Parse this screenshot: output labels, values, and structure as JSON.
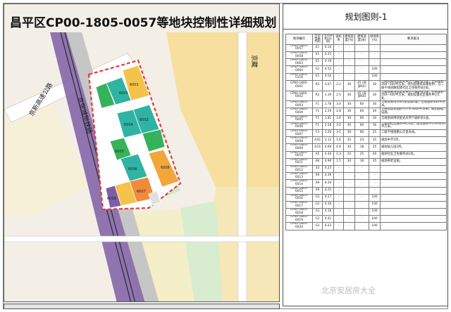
{
  "map": {
    "title": "昌平区CP00-1805-0057等地块控制性详细规划",
    "roads": {
      "expressway": "京新高速公路",
      "railway": "京张城际铁路",
      "beijing_tibet": "京藏"
    },
    "parcels": [
      {
        "label": "6001"
      },
      {
        "label": "6002"
      },
      {
        "label": "6003"
      },
      {
        "label": "6004"
      },
      {
        "label": "6005"
      },
      {
        "label": "6006"
      },
      {
        "label": "6007"
      },
      {
        "label": "6008"
      },
      {
        "label": "6009"
      }
    ],
    "colors": {
      "residential": "#f5c24a",
      "public_service": "#f28a3b",
      "green": "#35b35a",
      "teal": "#2fb3a3",
      "boundary": "#e23b3b",
      "road": "#ffffff",
      "railway_band": "#7d5ea6"
    }
  },
  "sheet": {
    "title": "规划图则-1"
  },
  "table": {
    "headers": [
      "地块编号",
      "用地性质代码",
      "用地面积(公顷)",
      "容积率",
      "建筑密度(%)",
      "建筑高度(米)",
      "绿地率(%)",
      "要求备注"
    ],
    "rows": [
      [
        "CP00-1805-0057",
        "E1",
        "0.14",
        "-",
        "-",
        "-",
        "-",
        "-"
      ],
      [
        "CP00-1805-0058",
        "E1",
        "0.25",
        "-",
        "-",
        "-",
        "-",
        "-"
      ],
      [
        "CP00-1805-0063",
        "E1",
        "0.19",
        "-",
        "-",
        "-",
        "-",
        "-"
      ],
      [
        "CP00-1805-0064",
        "G1",
        "0.52",
        "-",
        "-",
        "-",
        "100",
        "-"
      ],
      [
        "CP00-1805-0116",
        "E1",
        "0.54",
        "-",
        "-",
        "-",
        "100",
        "-"
      ],
      [
        "CP00-1805-6001",
        "R2",
        "3.07",
        "2.2",
        "30",
        "45 (局部60)",
        "30",
        "全规划采用装配式天然气锅炉房1座，占地面积200~300平方米，供内部建筑采暖使用；沿二级干线道路配建社区卫生服务站1处。"
      ],
      [
        "CP00-1805-6002",
        "R2",
        "3.19",
        "2.5",
        "30",
        "45 (局部60)",
        "30",
        "全规划采用装配式天然气锅炉房1座，占地面积200~300平方米，规划设置社区服务中心1处。"
      ],
      [
        "CP00-1805-6003",
        "F1",
        "1.78",
        "3.0",
        "30",
        "60",
        "30",
        "全规划采用10kV变电站1座，占地面积300平方米。"
      ],
      [
        "CP00-1805-6004",
        "F1",
        "2.29",
        "2.8",
        "30",
        "60",
        "30",
        "全规划建筑面积不少于5000平方米，规划基础设施。"
      ],
      [
        "CP00-1805-6005",
        "F1",
        "1.81",
        "3.0",
        "30",
        "60",
        "30",
        "全规划采用装配式天然气锅炉房1座。"
      ],
      [
        "CP00-1805-6006",
        "F1",
        "2.58",
        "3.0",
        "30",
        "60",
        "30",
        "全规划社区服务中心1处，建筑面积不小于6000平方米。"
      ],
      [
        "CP00-1805-6007",
        "F3",
        "1.20",
        "3.5",
        "30",
        "60",
        "25",
        "二级干线道路公交首末站。"
      ],
      [
        "CP00-1805-6008",
        "A33",
        "2.12",
        "1.6",
        "35",
        "24",
        "35",
        "规划中学1所。"
      ],
      [
        "CP00-1805-6009",
        "A33",
        "0.69",
        "0.9",
        "30",
        "18",
        "35",
        "规划幼儿园1所。"
      ],
      [
        "CP00-1805-6010",
        "A5",
        "0.30",
        "1.3",
        "25",
        "25",
        "40",
        "规划社区卫生服务站1处。"
      ],
      [
        "CP00-1805-6011",
        "A6",
        "0.90",
        "1.5",
        "30",
        "18",
        "35",
        "规划养老设施。"
      ],
      [
        "CP00-1805-6012",
        "S3",
        "0.23",
        "-",
        "-",
        "-",
        "-",
        "-"
      ],
      [
        "CP00-1805-6013",
        "S9",
        "0.39",
        "-",
        "-",
        "-",
        "-",
        "-"
      ],
      [
        "CP00-1805-6014",
        "S9",
        "0.20",
        "-",
        "-",
        "-",
        "-",
        "-"
      ],
      [
        "CP00-1805-6015",
        "S9",
        "0.25",
        "-",
        "-",
        "-",
        "-",
        "-"
      ],
      [
        "CP00-1805-6016",
        "G1",
        "0.27",
        "-",
        "-",
        "-",
        "100",
        "-"
      ],
      [
        "CP00-1805-6017",
        "G1",
        "0.34",
        "-",
        "-",
        "-",
        "100",
        "-"
      ],
      [
        "CP00-1805-6018",
        "G1",
        "0.16",
        "-",
        "-",
        "-",
        "100",
        "-"
      ],
      [
        "CP00-1805-6019",
        "G1",
        "0.41",
        "-",
        "-",
        "-",
        "100",
        "-"
      ],
      [
        "CP00-1805-6020",
        "G1",
        "0.22",
        "-",
        "-",
        "-",
        "100",
        "-"
      ]
    ]
  },
  "watermark": "北京安居房大全"
}
